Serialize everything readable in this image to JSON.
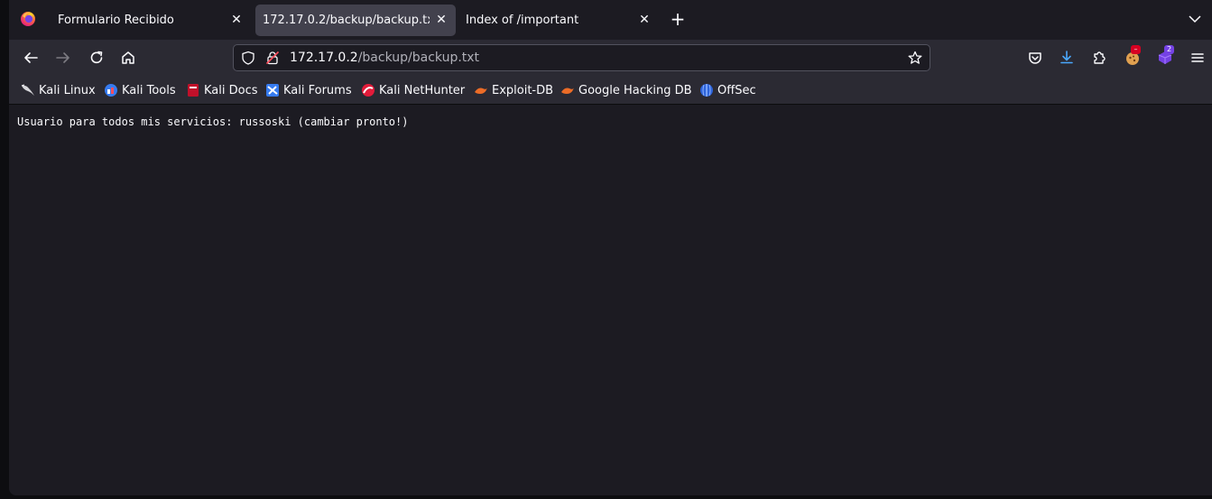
{
  "tabs": [
    {
      "label": "Formulario Recibido",
      "active": false
    },
    {
      "label": "172.17.0.2/backup/backup.txt",
      "active": true
    },
    {
      "label": "Index of /important",
      "active": false
    }
  ],
  "tab_close_glyph": "✕",
  "new_tab_glyph": "+",
  "url": {
    "host": "172.17.0.2",
    "path": "/backup/backup.txt"
  },
  "extensions": {
    "badge_count": "2"
  },
  "bookmarks": [
    {
      "label": "Kali Linux",
      "icon": "kali-dragon-icon"
    },
    {
      "label": "Kali Tools",
      "icon": "kali-tools-icon"
    },
    {
      "label": "Kali Docs",
      "icon": "kali-docs-icon"
    },
    {
      "label": "Kali Forums",
      "icon": "kali-forums-icon"
    },
    {
      "label": "Kali NetHunter",
      "icon": "kali-nethunter-icon"
    },
    {
      "label": "Exploit-DB",
      "icon": "exploit-db-icon"
    },
    {
      "label": "Google Hacking DB",
      "icon": "ghdb-icon"
    },
    {
      "label": "OffSec",
      "icon": "offsec-icon"
    }
  ],
  "content": {
    "text": "Usuario para todos mis servicios: russoski (cambiar pronto!)"
  },
  "colors": {
    "accent_download": "#4aa8ff",
    "active_tab": "#42414d",
    "toolbar": "#2b2a33",
    "background": "#1c1b22"
  }
}
